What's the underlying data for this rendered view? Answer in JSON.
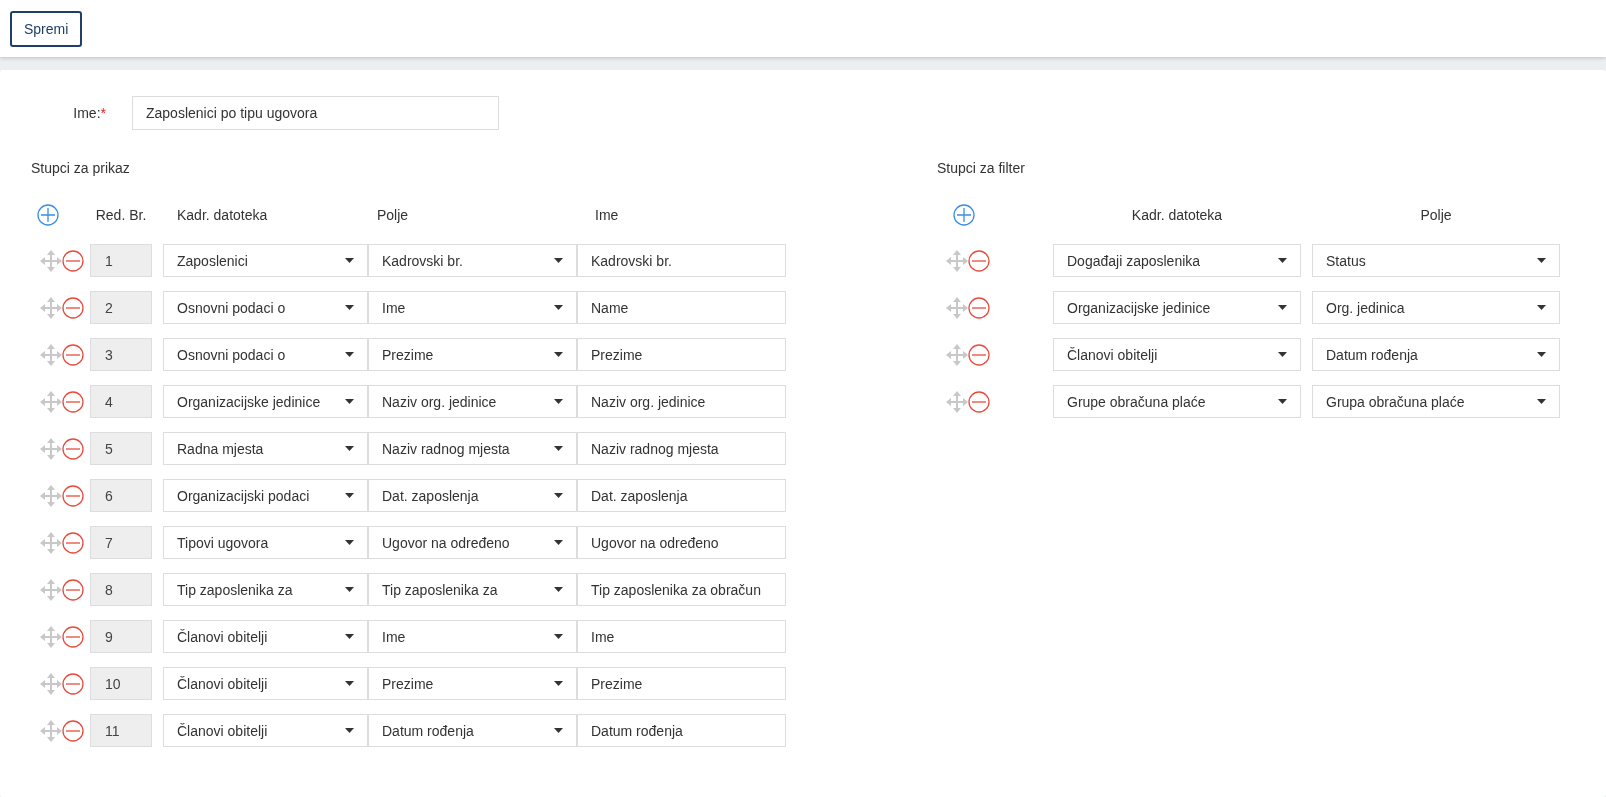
{
  "toolbar": {
    "save_button": "Spremi"
  },
  "name_field": {
    "label": "Ime:",
    "required_mark": "*",
    "value": "Zaposlenici po tipu ugovora"
  },
  "display_columns": {
    "title": "Stupci za prikaz",
    "headers": [
      "Red. Br.",
      "Kadr. datoteka",
      "Polje",
      "Ime"
    ],
    "rows": [
      {
        "number": "1",
        "file": "Zaposlenici",
        "field": "Kadrovski br.",
        "name": "Kadrovski br."
      },
      {
        "number": "2",
        "file": "Osnovni podaci o",
        "field": "Ime",
        "name": "Name"
      },
      {
        "number": "3",
        "file": "Osnovni podaci o",
        "field": "Prezime",
        "name": "Prezime"
      },
      {
        "number": "4",
        "file": "Organizacijske jedinice",
        "field": "Naziv org. jedinice",
        "name": "Naziv org. jedinice"
      },
      {
        "number": "5",
        "file": "Radna mjesta",
        "field": "Naziv radnog mjesta",
        "name": "Naziv radnog mjesta"
      },
      {
        "number": "6",
        "file": "Organizacijski podaci",
        "field": "Dat. zaposlenja",
        "name": "Dat. zaposlenja"
      },
      {
        "number": "7",
        "file": "Tipovi ugovora",
        "field": "Ugovor na određeno",
        "name": "Ugovor na određeno"
      },
      {
        "number": "8",
        "file": "Tip zaposlenika za",
        "field": "Tip zaposlenika za",
        "name": "Tip zaposlenika za obračun"
      },
      {
        "number": "9",
        "file": "Članovi obitelji",
        "field": "Ime",
        "name": "Ime"
      },
      {
        "number": "10",
        "file": "Članovi obitelji",
        "field": "Prezime",
        "name": "Prezime"
      },
      {
        "number": "11",
        "file": "Članovi obitelji",
        "field": "Datum rođenja",
        "name": "Datum rođenja"
      }
    ]
  },
  "filter_columns": {
    "title": "Stupci za filter",
    "headers": [
      "Kadr. datoteka",
      "Polje"
    ],
    "rows": [
      {
        "file": "Događaji zaposlenika",
        "field": "Status"
      },
      {
        "file": "Organizacijske jedinice",
        "field": "Org. jedinica"
      },
      {
        "file": "Članovi obitelji",
        "field": "Datum rođenja"
      },
      {
        "file": "Grupe obračuna plaće",
        "field": "Grupa obračuna plaće"
      }
    ]
  }
}
